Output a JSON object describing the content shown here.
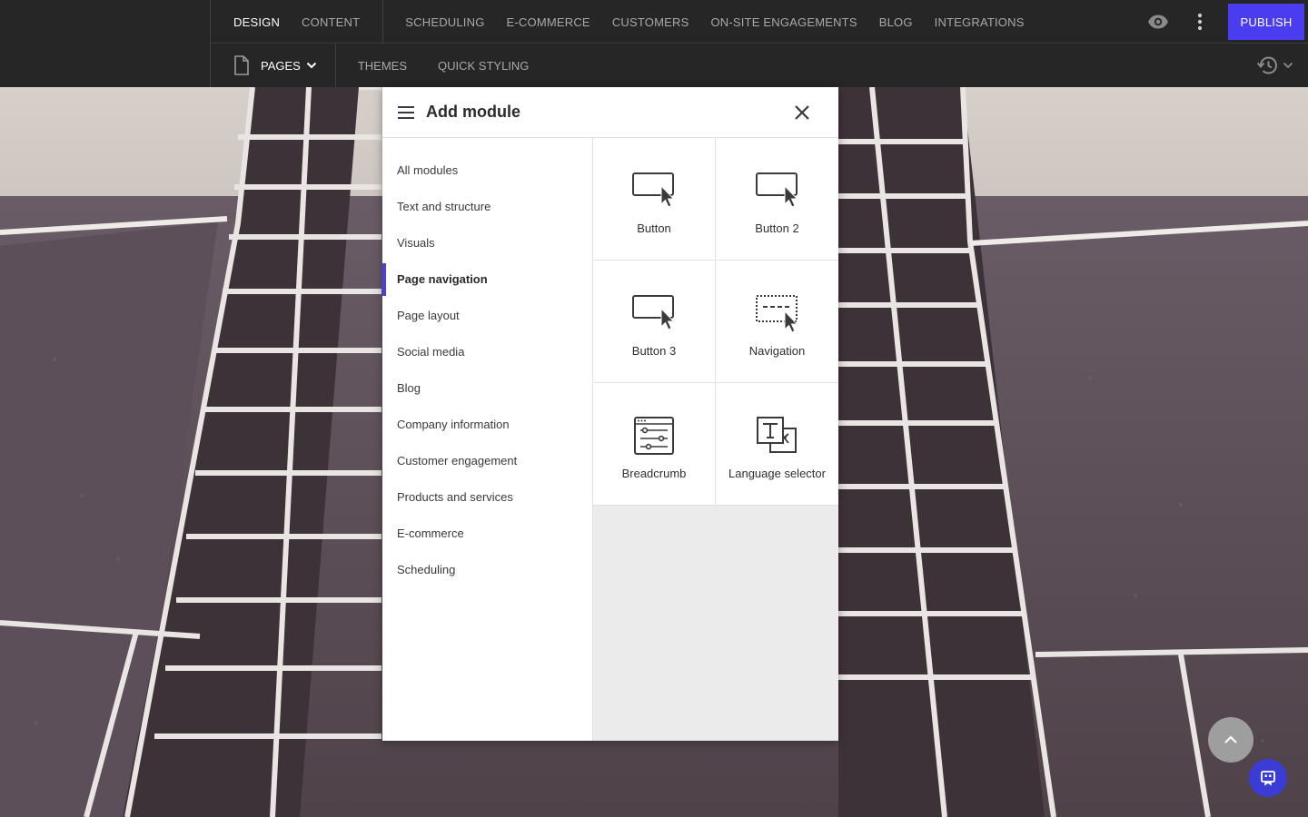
{
  "top_nav": {
    "tabs_primary": [
      "DESIGN",
      "CONTENT"
    ],
    "tabs_secondary": [
      "SCHEDULING",
      "E-COMMERCE",
      "CUSTOMERS",
      "ON-SITE ENGAGEMENTS",
      "BLOG",
      "INTEGRATIONS"
    ],
    "active_tab": "DESIGN",
    "preview_icon": "eye-icon",
    "more_icon": "more-vertical-icon",
    "publish_label": "PUBLISH",
    "accent_color": "#4a3df0"
  },
  "sub_nav": {
    "pages_label": "PAGES",
    "themes_label": "THEMES",
    "quick_styling_label": "QUICK STYLING",
    "history_icon": "history-icon"
  },
  "panel": {
    "title": "Add module",
    "categories": [
      "All modules",
      "Text and structure",
      "Visuals",
      "Page navigation",
      "Page layout",
      "Social media",
      "Blog",
      "Company information",
      "Customer engagement",
      "Products and services",
      "E-commerce",
      "Scheduling"
    ],
    "active_category": "Page navigation",
    "modules": [
      {
        "label": "Button",
        "icon": "button-icon"
      },
      {
        "label": "Button 2",
        "icon": "button-icon"
      },
      {
        "label": "Button 3",
        "icon": "button-icon"
      },
      {
        "label": "Navigation",
        "icon": "navigation-icon"
      },
      {
        "label": "Breadcrumb",
        "icon": "breadcrumb-icon"
      },
      {
        "label": "Language selector",
        "icon": "language-selector-icon"
      }
    ]
  }
}
